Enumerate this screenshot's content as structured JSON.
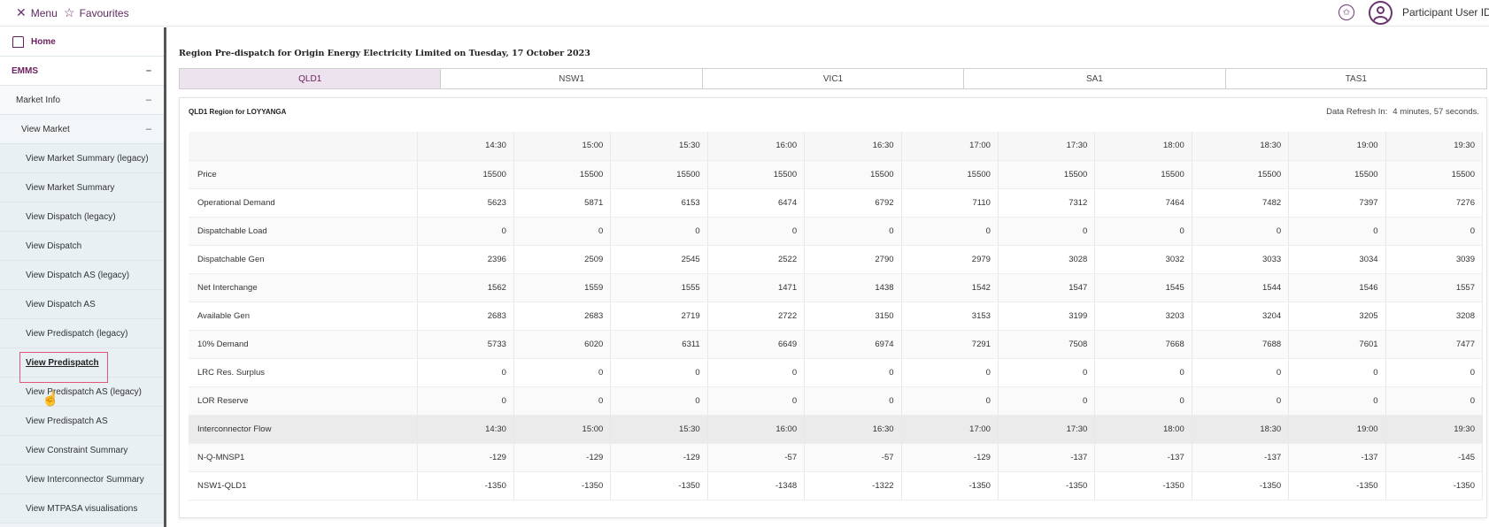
{
  "topbar": {
    "menu_icon": "close-x-icon",
    "menu_label": "Menu",
    "fav_icon": "star-icon",
    "fav_label": "Favourites",
    "user_label": "Participant User ID",
    "chevron": "˅"
  },
  "sidebar": {
    "home": "Home",
    "emms": "EMMS",
    "market_info": "Market Info",
    "view_market": "View Market",
    "collapse": "–",
    "items": [
      "View Market Summary (legacy)",
      "View Market Summary",
      "View Dispatch (legacy)",
      "View Dispatch",
      "View Dispatch AS (legacy)",
      "View Dispatch AS",
      "View Predispatch (legacy)",
      "View Predispatch",
      "View Predispatch AS (legacy)",
      "View Predispatch AS",
      "View Constraint Summary",
      "View Interconnector Summary",
      "View MTPASA visualisations"
    ],
    "active_index": 7
  },
  "main": {
    "title": "Region Pre-dispatch for Origin Energy Electricity Limited on Tuesday, 17 October 2023",
    "tabs": [
      "QLD1",
      "NSW1",
      "VIC1",
      "SA1",
      "TAS1"
    ],
    "active_tab": 0,
    "panel_title": "QLD1 Region for LOYYANGA",
    "refresh_label": "Data Refresh In:",
    "refresh_value": "4 minutes, 57 seconds.",
    "times": [
      "14:30",
      "15:00",
      "15:30",
      "16:00",
      "16:30",
      "17:00",
      "17:30",
      "18:00",
      "18:30",
      "19:00",
      "19:30"
    ],
    "rows": [
      {
        "label": "Price",
        "values": [
          "15500",
          "15500",
          "15500",
          "15500",
          "15500",
          "15500",
          "15500",
          "15500",
          "15500",
          "15500",
          "15500"
        ]
      },
      {
        "label": "Operational Demand",
        "values": [
          "5623",
          "5871",
          "6153",
          "6474",
          "6792",
          "7110",
          "7312",
          "7464",
          "7482",
          "7397",
          "7276"
        ]
      },
      {
        "label": "Dispatchable Load",
        "values": [
          "0",
          "0",
          "0",
          "0",
          "0",
          "0",
          "0",
          "0",
          "0",
          "0",
          "0"
        ]
      },
      {
        "label": "Dispatchable Gen",
        "values": [
          "2396",
          "2509",
          "2545",
          "2522",
          "2790",
          "2979",
          "3028",
          "3032",
          "3033",
          "3034",
          "3039"
        ]
      },
      {
        "label": "Net Interchange",
        "values": [
          "1562",
          "1559",
          "1555",
          "1471",
          "1438",
          "1542",
          "1547",
          "1545",
          "1544",
          "1546",
          "1557"
        ]
      },
      {
        "label": "Available Gen",
        "values": [
          "2683",
          "2683",
          "2719",
          "2722",
          "3150",
          "3153",
          "3199",
          "3203",
          "3204",
          "3205",
          "3208"
        ]
      },
      {
        "label": "10% Demand",
        "values": [
          "5733",
          "6020",
          "6311",
          "6649",
          "6974",
          "7291",
          "7508",
          "7668",
          "7688",
          "7601",
          "7477"
        ]
      },
      {
        "label": "LRC Res. Surplus",
        "values": [
          "0",
          "0",
          "0",
          "0",
          "0",
          "0",
          "0",
          "0",
          "0",
          "0",
          "0"
        ]
      },
      {
        "label": "LOR Reserve",
        "values": [
          "0",
          "0",
          "0",
          "0",
          "0",
          "0",
          "0",
          "0",
          "0",
          "0",
          "0"
        ]
      }
    ],
    "interconnector_label": "Interconnector Flow",
    "interconnector_rows": [
      {
        "label": "N-Q-MNSP1",
        "values": [
          "-129",
          "-129",
          "-129",
          "-57",
          "-57",
          "-129",
          "-137",
          "-137",
          "-137",
          "-137",
          "-145"
        ]
      },
      {
        "label": "NSW1-QLD1",
        "values": [
          "-1350",
          "-1350",
          "-1350",
          "-1348",
          "-1322",
          "-1350",
          "-1350",
          "-1350",
          "-1350",
          "-1350",
          "-1350"
        ]
      }
    ]
  }
}
